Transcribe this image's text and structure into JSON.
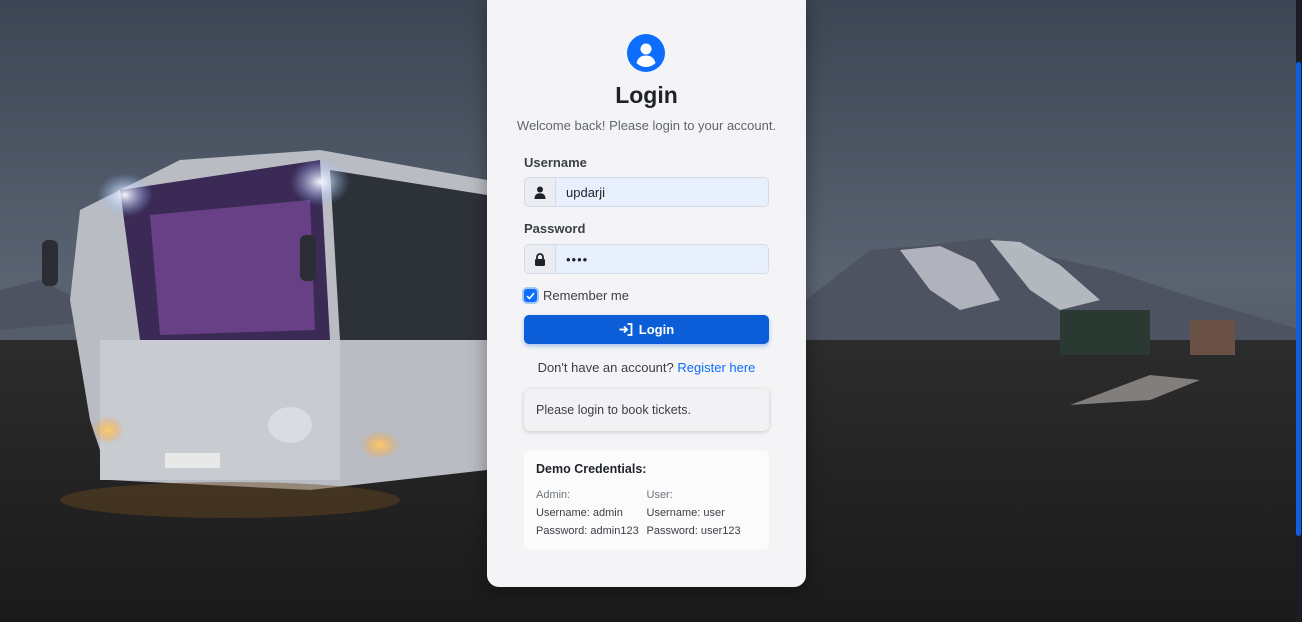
{
  "login": {
    "title": "Login",
    "subtitle": "Welcome back! Please login to your account.",
    "username_label": "Username",
    "username_value": "updarji",
    "password_label": "Password",
    "password_value": "••••",
    "remember_label": "Remember me",
    "remember_checked": true,
    "button_label": "Login",
    "register_prompt": "Don't have an account? ",
    "register_link": "Register here",
    "notice": "Please login to book tickets."
  },
  "demo": {
    "title": "Demo Credentials:",
    "admin": {
      "heading": "Admin:",
      "username": "Username: admin",
      "password": "Password: admin123"
    },
    "user": {
      "heading": "User:",
      "username": "Username: user",
      "password": "Password: user123"
    }
  },
  "colors": {
    "accent": "#0b5ed7",
    "link": "#0d6efd",
    "card": "#f4f4f6"
  },
  "icons": {
    "avatar": "user-circle-icon",
    "username": "user-icon",
    "password": "lock-icon",
    "button": "sign-in-icon"
  }
}
